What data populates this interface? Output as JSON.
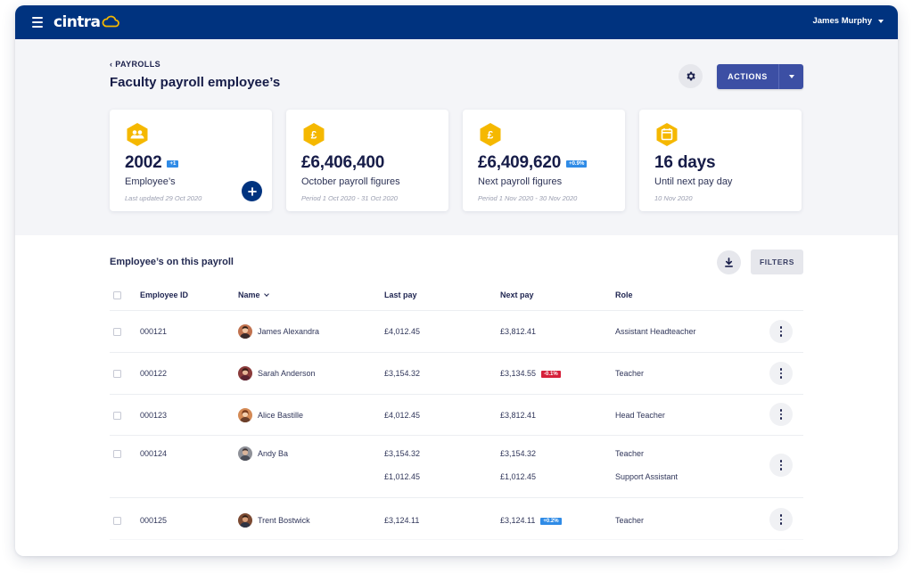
{
  "app": {
    "brand": "cintra",
    "user_name": "James Murphy"
  },
  "header": {
    "breadcrumb": "‹ PAYROLLS",
    "title": "Faculty payroll employee’s",
    "actions_label": "ACTIONS"
  },
  "cards": [
    {
      "icon": "people-icon",
      "value": "2002",
      "badge": "+1",
      "label": "Employee’s",
      "sub": "Last updated 29 Oct 2020"
    },
    {
      "icon": "pound-icon",
      "value": "£6,406,400",
      "badge": "",
      "label": "October payroll figures",
      "sub": "Period 1 Oct 2020 - 31 Oct 2020"
    },
    {
      "icon": "pound-icon",
      "value": "£6,409,620",
      "badge": "+0.9%",
      "label": "Next payroll figures",
      "sub": "Period 1 Nov 2020 - 30 Nov 2020"
    },
    {
      "icon": "calendar-icon",
      "value": "16 days",
      "badge": "",
      "label": "Until next pay day",
      "sub": "10 Nov 2020"
    }
  ],
  "section": {
    "title": "Employee’s on this payroll",
    "filters_label": "FILTERS"
  },
  "table": {
    "columns": [
      "Employee ID",
      "Name",
      "Last pay",
      "Next pay",
      "Role"
    ],
    "rows": [
      {
        "id": "000121",
        "name": "James Alexandra",
        "last_pay": "£4,012.45",
        "next_pay": "£3,812.41",
        "change": "",
        "role": "Assistant Headteacher",
        "last_pay_2": "",
        "next_pay_2": "",
        "role_2": ""
      },
      {
        "id": "000122",
        "name": "Sarah Anderson",
        "last_pay": "£3,154.32",
        "next_pay": "£3,134.55",
        "change": "-0.1%",
        "role": "Teacher",
        "last_pay_2": "",
        "next_pay_2": "",
        "role_2": ""
      },
      {
        "id": "000123",
        "name": "Alice Bastille",
        "last_pay": "£4,012.45",
        "next_pay": "£3,812.41",
        "change": "",
        "role": "Head Teacher",
        "last_pay_2": "",
        "next_pay_2": "",
        "role_2": ""
      },
      {
        "id": "000124",
        "name": "Andy Ba",
        "last_pay": "£3,154.32",
        "next_pay": "£3,154.32",
        "change": "",
        "role": "Teacher",
        "last_pay_2": "£1,012.45",
        "next_pay_2": "£1,012.45",
        "role_2": "Support Assistant"
      },
      {
        "id": "000125",
        "name": "Trent Bostwick",
        "last_pay": "£3,124.11",
        "next_pay": "£3,124.11",
        "change": "+0.2%",
        "role": "Teacher",
        "last_pay_2": "",
        "next_pay_2": "",
        "role_2": ""
      }
    ]
  },
  "colors": {
    "nav": "#00337f",
    "accent": "#3c4fa4",
    "hex_icon": "#f5b800",
    "badge_positive": "#2f8be6",
    "badge_negative": "#d6203a"
  }
}
